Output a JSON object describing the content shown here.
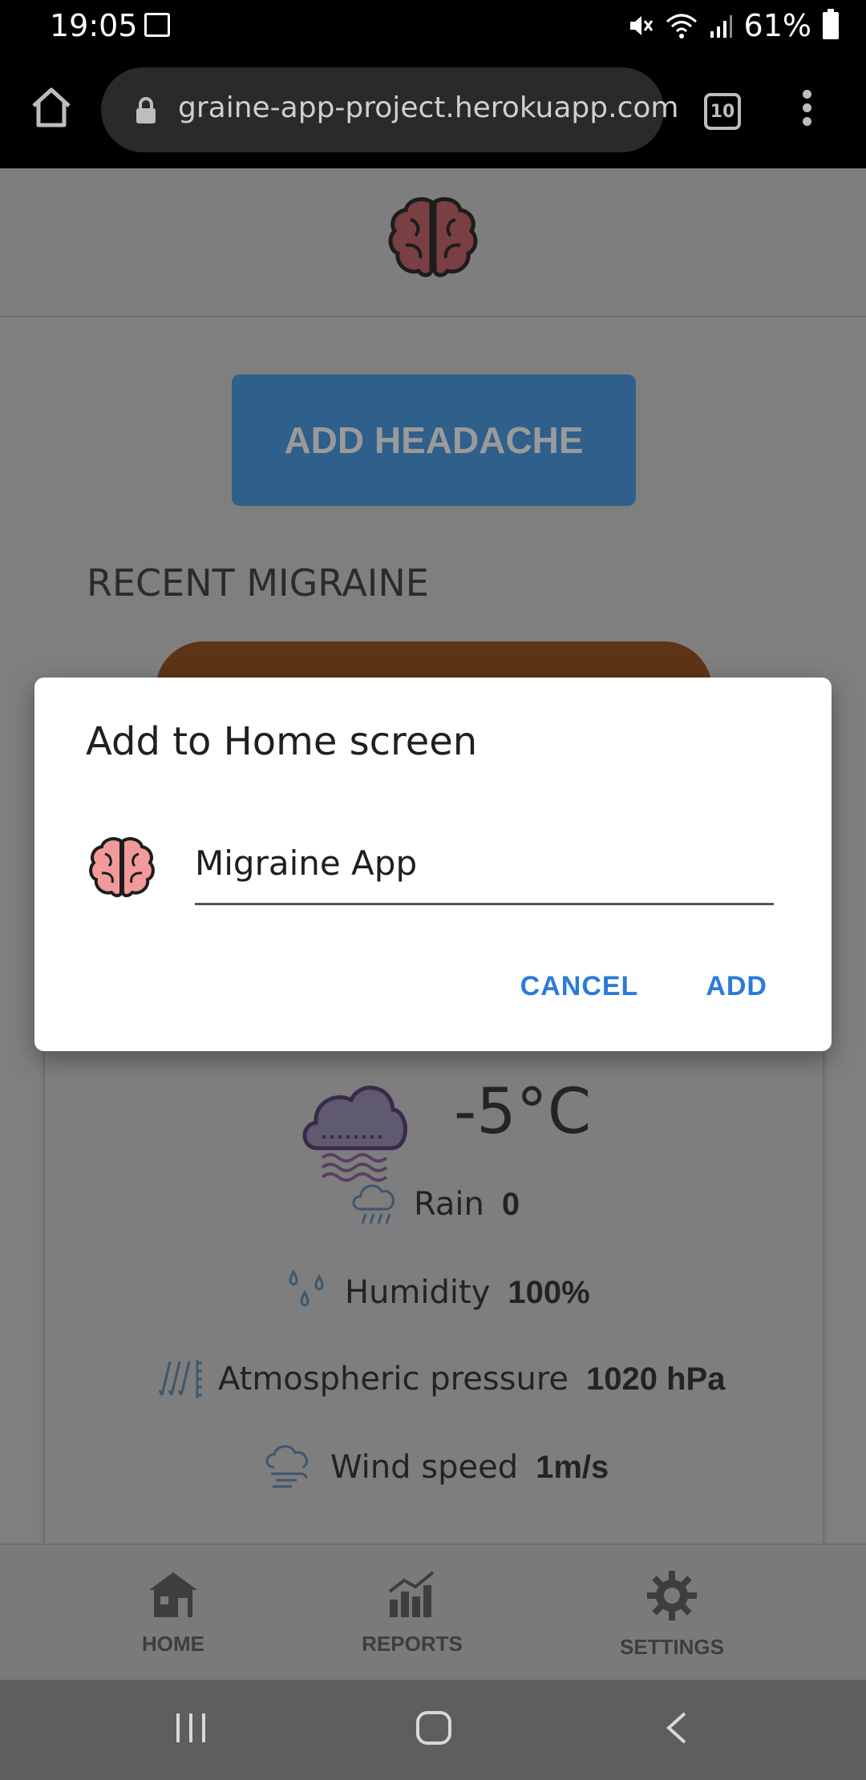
{
  "status_bar": {
    "time": "19:05",
    "battery": "61%"
  },
  "browser": {
    "url": "graine-app-project.herokuapp.com",
    "tab_count": "10"
  },
  "page": {
    "add_headache_label": "ADD HEADACHE",
    "recent_title": "RECENT MIGRAINE",
    "weather": {
      "temperature": "-5°C",
      "rain_label": "Rain",
      "rain_value": "0",
      "humidity_label": "Humidity",
      "humidity_value": "100%",
      "pressure_label": "Atmospheric pressure",
      "pressure_value": "1020 hPa",
      "wind_label": "Wind speed",
      "wind_value": "1m/s"
    }
  },
  "bottom_nav": {
    "home": "HOME",
    "reports": "REPORTS",
    "settings": "SETTINGS"
  },
  "dialog": {
    "title": "Add to Home screen",
    "app_name": "Migraine App",
    "cancel_label": "CANCEL",
    "add_label": "ADD"
  },
  "colors": {
    "accent": "#2b7bd8",
    "button_bg": "#2f5f8b"
  },
  "icons": [
    "home-icon",
    "lock-icon",
    "tabs-icon",
    "more-icon",
    "brain-icon",
    "cloud-icon",
    "rain-icon",
    "humidity-icon",
    "pressure-icon",
    "wind-icon",
    "house-icon",
    "chart-icon",
    "gear-icon"
  ]
}
